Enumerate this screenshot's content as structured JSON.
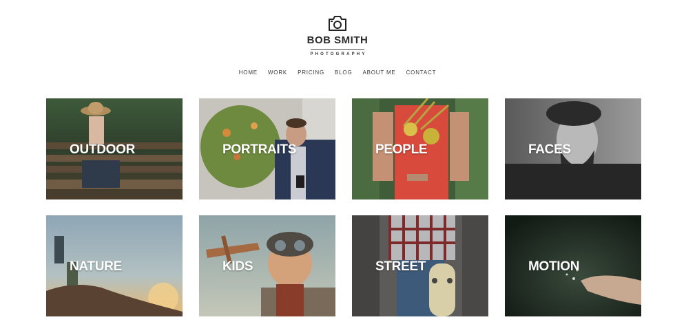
{
  "brand": {
    "name": "BOB SMITH",
    "subtitle": "PHOTOGRAPHY",
    "logo_icon": "camera-icon"
  },
  "nav": {
    "items": [
      "HOME",
      "WORK",
      "PRICING",
      "BLOG",
      "ABOUT ME",
      "CONTACT"
    ]
  },
  "gallery": {
    "tiles": [
      {
        "label": "OUTDOOR"
      },
      {
        "label": "PORTRAITS"
      },
      {
        "label": "PEOPLE"
      },
      {
        "label": "FACES"
      },
      {
        "label": "NATURE"
      },
      {
        "label": "KIDS"
      },
      {
        "label": "STREET"
      },
      {
        "label": "MOTION"
      }
    ]
  }
}
